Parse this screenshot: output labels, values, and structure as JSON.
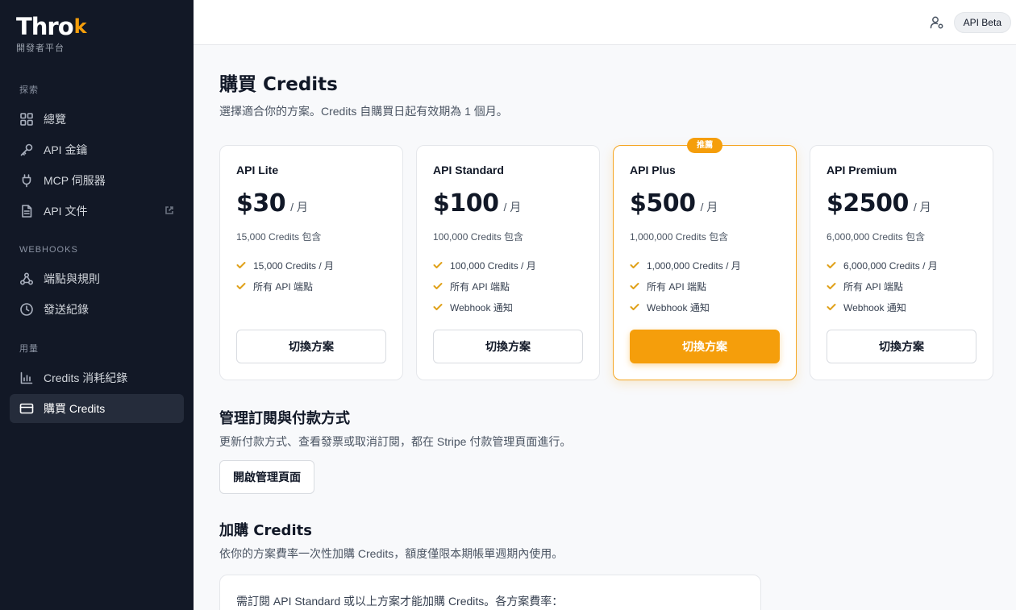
{
  "brand": {
    "name_main": "Thro",
    "name_accent": "k",
    "subtitle": "開發者平台"
  },
  "sidebar": {
    "sections": [
      {
        "heading": "探索",
        "items": [
          {
            "label": "總覽",
            "icon": "dashboard-icon"
          },
          {
            "label": "API 金鑰",
            "icon": "key-icon"
          },
          {
            "label": "MCP 伺服器",
            "icon": "plug-icon"
          },
          {
            "label": "API 文件",
            "icon": "document-icon",
            "external": true
          }
        ]
      },
      {
        "heading": "WEBHOOKS",
        "items": [
          {
            "label": "端點與規則",
            "icon": "webhook-icon"
          },
          {
            "label": "發送紀錄",
            "icon": "clock-icon"
          }
        ]
      },
      {
        "heading": "用量",
        "items": [
          {
            "label": "Credits 消耗紀錄",
            "icon": "bar-chart-icon"
          },
          {
            "label": "購買 Credits",
            "icon": "credit-card-icon",
            "active": true
          }
        ]
      }
    ]
  },
  "topbar": {
    "badge": "API Beta"
  },
  "page": {
    "title": "購買 Credits",
    "subtitle": "選擇適合你的方案。Credits 自購買日起有效期為 1 個月。"
  },
  "plans": [
    {
      "name": "API Lite",
      "price": "$30",
      "per": "/ 月",
      "included": "15,000 Credits 包含",
      "features": [
        "15,000 Credits / 月",
        "所有 API 端點"
      ],
      "button": "切換方案"
    },
    {
      "name": "API Standard",
      "price": "$100",
      "per": "/ 月",
      "included": "100,000 Credits 包含",
      "features": [
        "100,000 Credits / 月",
        "所有 API 端點",
        "Webhook 通知"
      ],
      "button": "切換方案"
    },
    {
      "name": "API Plus",
      "price": "$500",
      "per": "/ 月",
      "included": "1,000,000 Credits 包含",
      "features": [
        "1,000,000 Credits / 月",
        "所有 API 端點",
        "Webhook 通知"
      ],
      "button": "切換方案",
      "featured": true,
      "badge": "推薦"
    },
    {
      "name": "API Premium",
      "price": "$2500",
      "per": "/ 月",
      "included": "6,000,000 Credits 包含",
      "features": [
        "6,000,000 Credits / 月",
        "所有 API 端點",
        "Webhook 通知"
      ],
      "button": "切換方案"
    }
  ],
  "manage": {
    "title": "管理訂閱與付款方式",
    "subtitle": "更新付款方式、查看發票或取消訂閱，都在 Stripe 付款管理頁面進行。",
    "button": "開啟管理頁面"
  },
  "addon": {
    "title": "加購 Credits",
    "subtitle": "依你的方案費率一次性加購 Credits，額度僅限本期帳單週期內使用。",
    "notice": "需訂閱 API Standard 或以上方案才能加購 Credits。各方案費率："
  },
  "colors": {
    "accent": "#f59e0b",
    "sidebar_bg": "#121826",
    "page_bg": "#f8f9fb"
  }
}
